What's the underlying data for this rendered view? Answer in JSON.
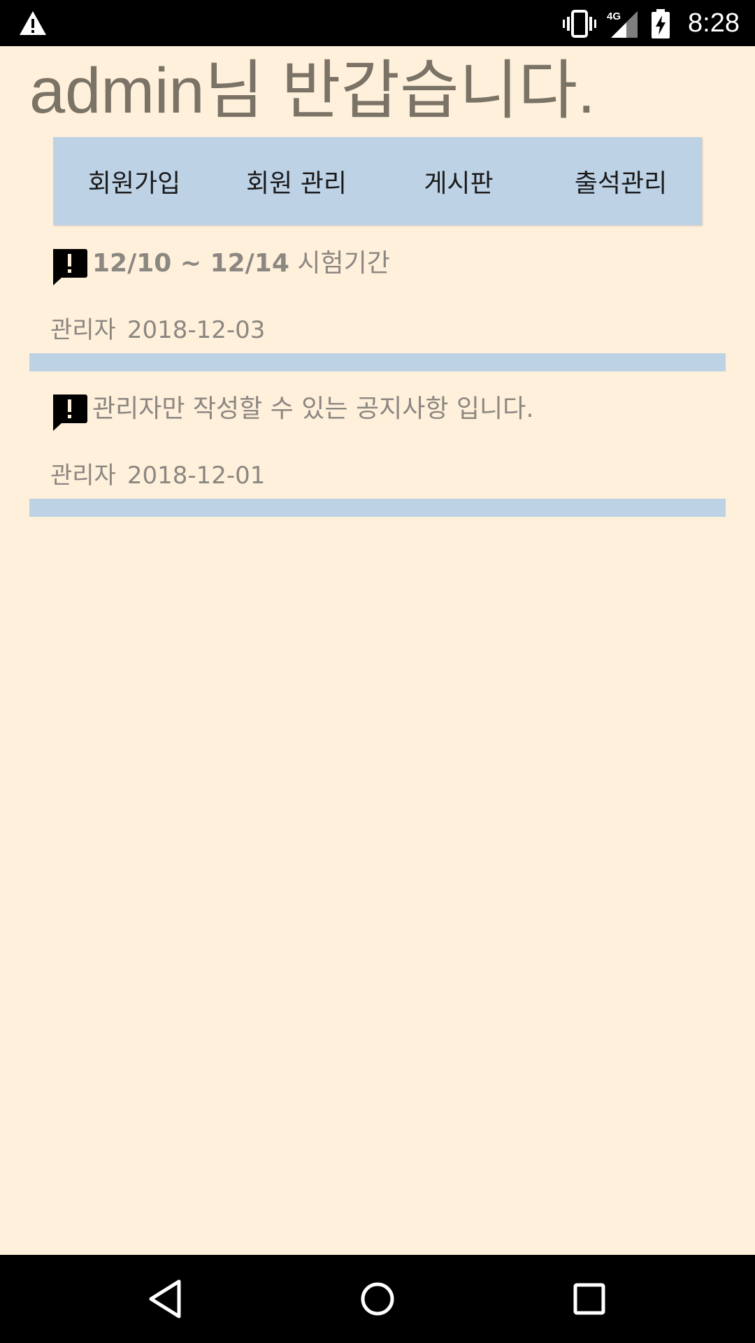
{
  "status_bar": {
    "time": "8:28",
    "network": "4G",
    "icons": [
      "warning-icon",
      "vibrate-icon",
      "signal-icon",
      "battery-charging-icon"
    ]
  },
  "greeting": "admin님 반갑습니다.",
  "nav": {
    "items": [
      {
        "label": "회원가입"
      },
      {
        "label": "회원 관리"
      },
      {
        "label": "게시판"
      },
      {
        "label": "출석관리"
      }
    ]
  },
  "notices": [
    {
      "icon": "announcement-icon",
      "title_bold": "12/10 ~ 12/14",
      "title_rest": " 시험기간",
      "author": "관리자",
      "date": "2018-12-03"
    },
    {
      "icon": "announcement-icon",
      "title_bold": "",
      "title_rest": "관리자만 작성할 수 있는 공지사항 입니다.",
      "author": "관리자",
      "date": "2018-12-01"
    }
  ],
  "navigation_bar": {
    "buttons": [
      "back-icon",
      "home-icon",
      "recents-icon"
    ]
  },
  "colors": {
    "background": "#fff0db",
    "accent": "#bed2e6",
    "greeting_text": "#7a7366",
    "muted_text": "#8b8781"
  }
}
